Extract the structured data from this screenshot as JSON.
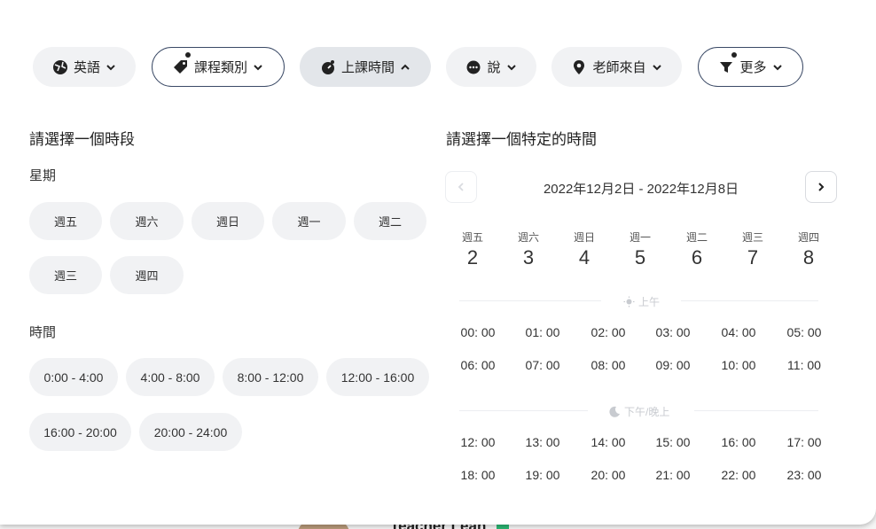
{
  "filters": [
    {
      "label": "英語",
      "icon": "language-icon"
    },
    {
      "label": "課程類別",
      "icon": "tag-icon"
    },
    {
      "label": "上課時間",
      "icon": "clock-icon"
    },
    {
      "label": "說",
      "icon": "speech-icon"
    },
    {
      "label": "老師來自",
      "icon": "location-pin-icon"
    },
    {
      "label": "更多",
      "icon": "filter-icon"
    }
  ],
  "period_section": {
    "title": "請選擇一個時段",
    "weekday_label": "星期",
    "weekdays": [
      "週五",
      "週六",
      "週日",
      "週一",
      "週二",
      "週三",
      "週四"
    ],
    "time_label": "時間",
    "time_ranges": [
      "0:00 - 4:00",
      "4:00 - 8:00",
      "8:00 - 12:00",
      "12:00 - 16:00",
      "16:00 - 20:00",
      "20:00 - 24:00"
    ]
  },
  "specific_section": {
    "title": "請選擇一個特定的時間",
    "date_range": "2022年12月2日 - 2022年12月8日",
    "days": [
      {
        "weekday": "週五",
        "date": "2"
      },
      {
        "weekday": "週六",
        "date": "3"
      },
      {
        "weekday": "週日",
        "date": "4"
      },
      {
        "weekday": "週一",
        "date": "5"
      },
      {
        "weekday": "週二",
        "date": "6"
      },
      {
        "weekday": "週三",
        "date": "7"
      },
      {
        "weekday": "週四",
        "date": "8"
      }
    ],
    "morning_label": "上午",
    "morning_slots": [
      "00: 00",
      "01: 00",
      "02: 00",
      "03: 00",
      "04: 00",
      "05: 00",
      "06: 00",
      "07: 00",
      "08: 00",
      "09: 00",
      "10: 00",
      "11: 00"
    ],
    "evening_label": "下午/晚上",
    "evening_slots": [
      "12: 00",
      "13: 00",
      "14: 00",
      "15: 00",
      "16: 00",
      "17: 00",
      "18: 00",
      "19: 00",
      "20: 00",
      "21: 00",
      "22: 00",
      "23: 00"
    ]
  },
  "backdrop": {
    "teacher_name": "Teacher Leah"
  }
}
